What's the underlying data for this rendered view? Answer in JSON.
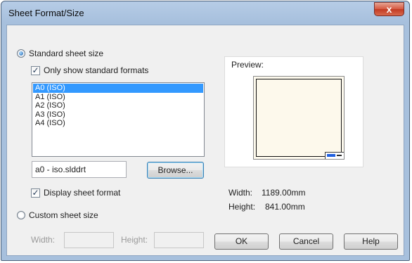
{
  "window": {
    "title": "Sheet Format/Size",
    "close_glyph": "x"
  },
  "standard": {
    "radio_label": "Standard sheet size",
    "only_standard_label": "Only show standard formats",
    "formats": [
      "A0 (ISO)",
      "A1 (ISO)",
      "A2 (ISO)",
      "A3 (ISO)",
      "A4 (ISO)"
    ],
    "selected_format": "A0 (ISO)",
    "file_value": "a0 - iso.slddrt",
    "browse_label": "Browse...",
    "display_format_label": "Display sheet format"
  },
  "preview": {
    "label": "Preview:",
    "width_label": "Width:",
    "width_value": "1189.00mm",
    "height_label": "Height:",
    "height_value": "841.00mm"
  },
  "custom": {
    "radio_label": "Custom sheet size",
    "width_label": "Width:",
    "height_label": "Height:"
  },
  "buttons": {
    "ok": "OK",
    "cancel": "Cancel",
    "help": "Help"
  },
  "colors": {
    "selection": "#3399ff",
    "title_bar": "#a7c0dd",
    "close_button": "#c94a31"
  }
}
